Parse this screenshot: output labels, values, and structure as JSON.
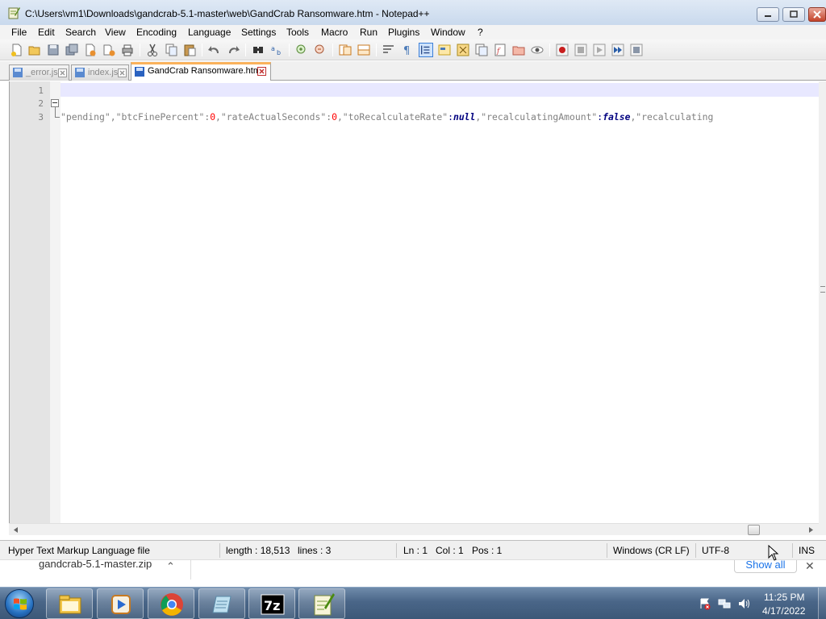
{
  "window": {
    "title": "C:\\Users\\vm1\\Downloads\\gandcrab-5.1-master\\web\\GandCrab Ransomware.htm - Notepad++"
  },
  "menu": [
    "File",
    "Edit",
    "Search",
    "View",
    "Encoding",
    "Language",
    "Settings",
    "Tools",
    "Macro",
    "Run",
    "Plugins",
    "Window",
    "?"
  ],
  "tabs": [
    {
      "label": "_error.js",
      "active": false
    },
    {
      "label": "index.js",
      "active": false
    },
    {
      "label": "GandCrab Ransomware.htm",
      "active": true
    }
  ],
  "editor": {
    "line_numbers": [
      "1",
      "2",
      "3"
    ],
    "line3_tokens": [
      {
        "t": "\"pending\"",
        "k": "str"
      },
      {
        "t": ",",
        "k": "str"
      },
      {
        "t": "\"btcFinePercent\"",
        "k": "str"
      },
      {
        "t": ":",
        "k": "str"
      },
      {
        "t": "0",
        "k": "num"
      },
      {
        "t": ",",
        "k": "str"
      },
      {
        "t": "\"rateActualSeconds\"",
        "k": "str"
      },
      {
        "t": ":",
        "k": "str"
      },
      {
        "t": "0",
        "k": "num"
      },
      {
        "t": ",",
        "k": "str"
      },
      {
        "t": "\"toRecalculateRate\"",
        "k": "str"
      },
      {
        "t": ":",
        "k": "op"
      },
      {
        "t": "null",
        "k": "kw"
      },
      {
        "t": ",",
        "k": "str"
      },
      {
        "t": "\"recalculatingAmount\"",
        "k": "str"
      },
      {
        "t": ":",
        "k": "op"
      },
      {
        "t": "false",
        "k": "kw"
      },
      {
        "t": ",",
        "k": "str"
      },
      {
        "t": "\"recalculating",
        "k": "str"
      }
    ]
  },
  "status": {
    "file_type": "Hyper Text Markup Language file",
    "length": "length : 18,513",
    "lines": "lines : 3",
    "ln": "Ln : 1",
    "col": "Col : 1",
    "pos": "Pos : 1",
    "eol": "Windows (CR LF)",
    "encoding": "UTF-8",
    "mode": "INS"
  },
  "download_bar": {
    "item": "gandcrab-5.1-master.zip",
    "show_all": "Show all"
  },
  "taskbar": {
    "apps": [
      "explorer-icon",
      "media-player-icon",
      "chrome-icon",
      "notepad-icon",
      "7zip-icon",
      "notepadpp-icon"
    ],
    "time": "11:25 PM",
    "date": "4/17/2022"
  }
}
